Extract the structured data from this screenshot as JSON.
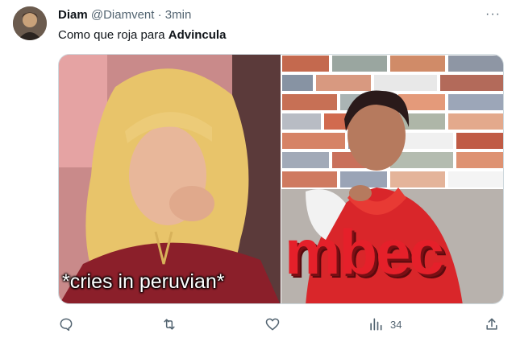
{
  "tweet": {
    "display_name": "Diam",
    "handle": "@Diamvent",
    "separator": "·",
    "time": "3min",
    "text_prefix": "Como que roja para",
    "text_bold": "Advincula",
    "more_label": "···"
  },
  "media": {
    "left_caption": "*cries in peruvian*",
    "right_overlay_text": "mbec"
  },
  "actions": {
    "reply_icon": "reply-icon",
    "retweet_icon": "retweet-icon",
    "like_icon": "heart-icon",
    "views_icon": "views-icon",
    "views_count": "34",
    "share_icon": "share-icon"
  }
}
